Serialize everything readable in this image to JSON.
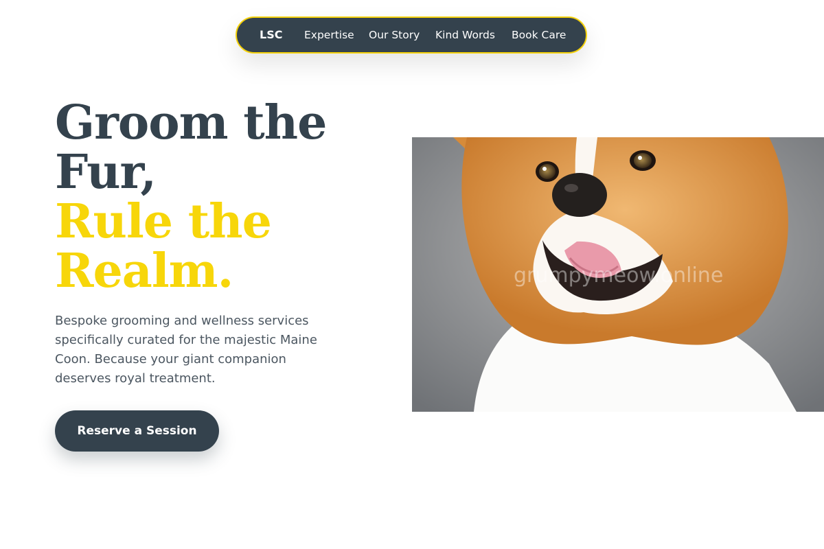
{
  "nav": {
    "logo": "LSC",
    "links": [
      "Expertise",
      "Our Story",
      "Kind Words",
      "Book Care"
    ],
    "accent_color": "#f4d10a",
    "background": "#34424d"
  },
  "hero": {
    "title_lines": [
      "Groom the",
      "Fur,"
    ],
    "accent_lines": [
      "Rule the",
      "Realm."
    ],
    "title_color": "#34424d",
    "accent_color": "#f7d60a",
    "description": "Bespoke grooming and wellness services specifically curated for the majestic Maine Coon. Because your giant companion deserves royal treatment.",
    "cta_label": "Reserve a Session",
    "image_alt": "Smiling corgi dog",
    "watermark": "grumpymeow.online"
  }
}
